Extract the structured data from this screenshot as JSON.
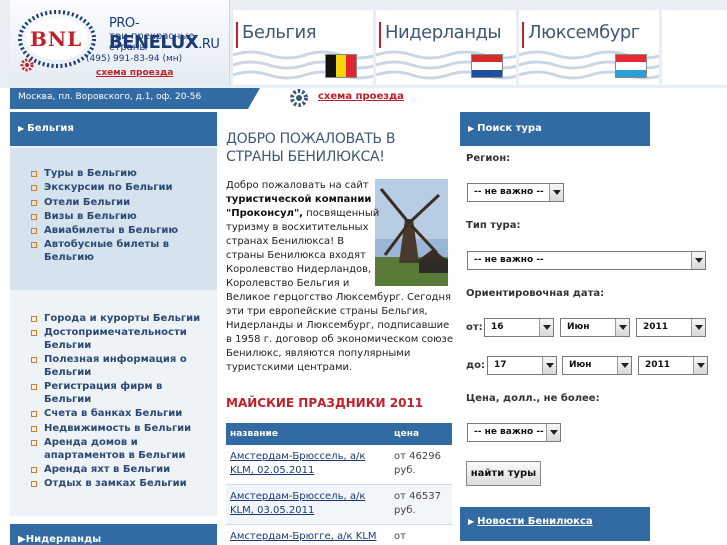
{
  "logo": {
    "abbr": "BNL",
    "site_prefix": "PRO-",
    "site_main": "BENELUX",
    "site_suffix": ".RU",
    "slogan": "три прекрасные страны",
    "phone": "(495) 991-83-94 (мн)",
    "map_link": "схема проезда"
  },
  "country_tabs": [
    {
      "label": "Бельгия",
      "flag_colors": [
        "#111111",
        "#f5d40b",
        "#e2262e"
      ],
      "flag_orientation": "vertical"
    },
    {
      "label": "Нидерланды",
      "flag_colors": [
        "#d52b2b",
        "#ffffff",
        "#1f4fa0"
      ],
      "flag_orientation": "horizontal"
    },
    {
      "label": "Люксембург",
      "flag_colors": [
        "#e52a35",
        "#ffffff",
        "#2b9fd8"
      ],
      "flag_orientation": "horizontal"
    }
  ],
  "address": {
    "text": "Москва, пл. Воровского, д.1, оф. 20-56",
    "map_link": "схема проезда"
  },
  "left_sidebar": {
    "header": "Бельгия",
    "menu_primary": [
      "Туры в Бельгию",
      "Экскурсии по Бельгии",
      "Отели Бельгии",
      "Визы в Бельгию",
      "Авиабилеты в Бельгию",
      "Автобусные билеты в Бельгию"
    ],
    "menu_secondary": [
      "Города и курорты Бельгии",
      "Достопримечательности Бельгии",
      "Полезная информация о Бельгии",
      "Регистрация фирм в Бельгии",
      "Счета в банках Бельгии",
      "Недвижимость в Бельгии",
      "Аренда домов и апартаментов в Бельгии",
      "Аренда яхт в Бельгии",
      "Отдых в замках Бельгии"
    ],
    "footer": "Нидерланды"
  },
  "main": {
    "welcome_title": "ДОБРО ПОЖАЛОВАТЬ В СТРАНЫ БЕНИЛЮКСА!",
    "intro_before": "Добро пожаловать на сайт ",
    "intro_bold": "туристической компании \"Проконсул\",",
    "intro_after": " посвященный туризму в восхитительных странах Бенилюкса! В страны Бенилюкса входят Королевство Нидерландов, Королевство Бельгия и Великое герцогство Люксембург. Сегодня эти три европейские страны  Бельгия, Нидерланды и Люксембург, подписавшие в 1958 г. договор об экономическом союзе Бенилюкс, являются популярными туристскими центрами.",
    "may_title": "МАЙСКИЕ ПРАЗДНИКИ 2011",
    "table": {
      "headers": [
        "название",
        "цена"
      ],
      "rows": [
        {
          "name": "Амстердам-Брюссель, а/к KLM, 02.05.2011",
          "price": "от 46296 руб."
        },
        {
          "name": "Амстердам-Брюссель, а/к KLM, 03.05.2011",
          "price": "от 46537 руб."
        },
        {
          "name": "Амстердам-Брюгге, а/к KLM",
          "price": "от"
        }
      ]
    }
  },
  "search": {
    "header": "Поиск тура",
    "region_label": "Регион:",
    "region_value": "-- не важно --",
    "tour_type_label": "Тип тура:",
    "tour_type_value": "-- не важно --",
    "date_label": "Ориентировочная дата:",
    "from_label": "от:",
    "from_day": "16",
    "from_month": "Июн",
    "from_year": "2011",
    "to_label": "до:",
    "to_day": "17",
    "to_month": "Июн",
    "to_year": "2011",
    "price_label": "Цена, долл., не более:",
    "price_value": "-- не важно --",
    "submit": "найти туры"
  },
  "news": {
    "header": "Новости Бенилюкса"
  }
}
